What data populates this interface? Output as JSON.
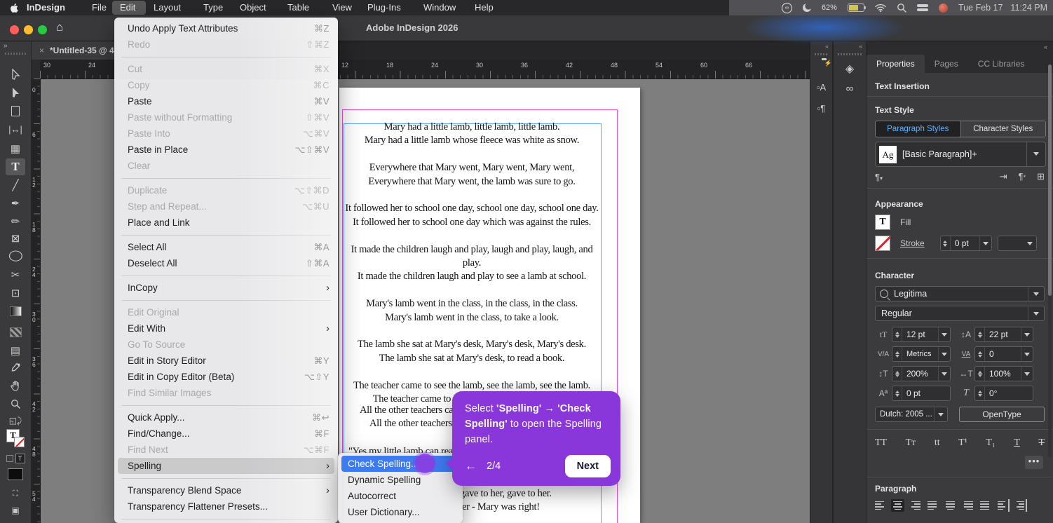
{
  "menubar": {
    "app_name": "InDesign",
    "items": [
      "File",
      "Edit",
      "Layout",
      "Type",
      "Object",
      "Table",
      "View",
      "Plug-Ins",
      "Window",
      "Help"
    ],
    "active_item": "Edit",
    "status": {
      "battery_percent": "62%",
      "date": "Tue Feb 17",
      "time": "11:24 PM"
    },
    "status_icons": [
      "creative-cloud-icon",
      "moon-icon",
      "battery-icon",
      "wifi-icon",
      "search-icon",
      "control-center-icon",
      "red-status-icon"
    ]
  },
  "titlebar": {
    "title": "Adobe InDesign 2026"
  },
  "document_tab": {
    "close": "×",
    "label": "*Untitled-35 @ 4"
  },
  "rulers": {
    "h_left": [
      "30",
      "24"
    ],
    "h_right": [
      "12",
      "18",
      "24",
      "30",
      "36",
      "42",
      "48",
      "54",
      "60",
      "66"
    ],
    "vertical": [
      "0",
      "6",
      "12",
      "18",
      "24",
      "30",
      "36",
      "42",
      "48",
      "54"
    ]
  },
  "toolbar": {
    "expander": "»",
    "tools": [
      "selection-tool",
      "direct-selection-tool",
      "page-tool",
      "gap-tool",
      "content-collector-tool",
      "type-tool",
      "line-tool",
      "pen-tool",
      "pencil-tool",
      "rectangle-frame-tool",
      "ellipse-tool",
      "scissors-tool",
      "free-transform-tool",
      "gradient-swatch-tool",
      "gradient-feather-tool",
      "note-tool",
      "eyedropper-tool",
      "hand-tool",
      "zoom-tool",
      "swap-fill-stroke",
      "fill-stroke-proxy",
      "formatting-toggles",
      "apply-color",
      "screen-mode"
    ],
    "active_tool": "type-tool"
  },
  "edit_menu": {
    "title": "Edit",
    "items": [
      {
        "label": "Undo Apply Text Attributes",
        "shortcut": "⌘Z",
        "enabled": true
      },
      {
        "label": "Redo",
        "shortcut": "⇧⌘Z",
        "enabled": false
      },
      {
        "label": "Cut",
        "shortcut": "⌘X",
        "enabled": false
      },
      {
        "label": "Copy",
        "shortcut": "⌘C",
        "enabled": false
      },
      {
        "label": "Paste",
        "shortcut": "⌘V",
        "enabled": true
      },
      {
        "label": "Paste without Formatting",
        "shortcut": "⇧⌘V",
        "enabled": false
      },
      {
        "label": "Paste Into",
        "shortcut": "⌥⌘V",
        "enabled": false
      },
      {
        "label": "Paste in Place",
        "shortcut": "⌥⇧⌘V",
        "enabled": true
      },
      {
        "label": "Clear",
        "shortcut": "",
        "enabled": false
      },
      {
        "label": "Duplicate",
        "shortcut": "⌥⇧⌘D",
        "enabled": false
      },
      {
        "label": "Step and Repeat...",
        "shortcut": "⌥⌘U",
        "enabled": false
      },
      {
        "label": "Place and Link",
        "shortcut": "",
        "enabled": true
      },
      {
        "label": "Select All",
        "shortcut": "⌘A",
        "enabled": true
      },
      {
        "label": "Deselect All",
        "shortcut": "⇧⌘A",
        "enabled": true
      },
      {
        "label": "InCopy",
        "shortcut": "›",
        "enabled": true
      },
      {
        "label": "Edit Original",
        "shortcut": "",
        "enabled": false
      },
      {
        "label": "Edit With",
        "shortcut": "›",
        "enabled": true
      },
      {
        "label": "Go To Source",
        "shortcut": "",
        "enabled": false
      },
      {
        "label": "Edit in Story Editor",
        "shortcut": "⌘Y",
        "enabled": true
      },
      {
        "label": "Edit in Copy Editor (Beta)",
        "shortcut": "⌥⇧Y",
        "enabled": true
      },
      {
        "label": "Find Similar Images",
        "shortcut": "",
        "enabled": false
      },
      {
        "label": "Quick Apply...",
        "shortcut": "⌘↩",
        "enabled": true
      },
      {
        "label": "Find/Change...",
        "shortcut": "⌘F",
        "enabled": true
      },
      {
        "label": "Find Next",
        "shortcut": "⌥⌘F",
        "enabled": false
      },
      {
        "label": "Spelling",
        "shortcut": "›",
        "enabled": true,
        "highlighted": true
      },
      {
        "label": "Transparency Blend Space",
        "shortcut": "›",
        "enabled": true
      },
      {
        "label": "Transparency Flattener Presets...",
        "shortcut": "",
        "enabled": true
      }
    ]
  },
  "spelling_submenu": {
    "items": [
      {
        "label": "Check Spelling...",
        "selected": true
      },
      {
        "label": "Dynamic Spelling",
        "selected": false
      },
      {
        "label": "Autocorrect",
        "selected": false
      },
      {
        "label": "User Dictionary...",
        "selected": false
      }
    ]
  },
  "tutorial_tooltip": {
    "text_runs": [
      {
        "t": "Select "
      },
      {
        "t": "'Spelling'"
      },
      {
        "t": " → "
      },
      {
        "t": "'Check Spelling'"
      },
      {
        "t": " to open the Spelling panel."
      }
    ],
    "back_icon": "←",
    "step": "2/4",
    "next_label": "Next",
    "accent_color": "#8936db"
  },
  "document": {
    "stanzas": [
      [
        "Mary had a little lamb, little lamb, little lamb.",
        "Mary had a little lamb whose fleece was white as snow."
      ],
      [
        "Everywhere that Mary went, Mary went, Mary went,",
        "Everywhere that Mary went, the lamb was sure to go."
      ],
      [
        "It followed her to school one day, school one day, school one day.",
        "It followed her to school one day which was against the rules."
      ],
      [
        "It made the children laugh and play, laugh and play, laugh, and play.",
        "It made the children laugh and play to see a lamb at school."
      ],
      [
        "Mary's lamb went in the class, in the class, in the class.",
        "Mary's lamb went in the class, to take a look."
      ],
      [
        "The lamb she sat at Mary's desk, Mary's desk, Mary's desk.",
        "The lamb she sat at Mary's desk, to read a book."
      ],
      [
        "The teacher came to see the lamb, see the lamb, see the lamb.",
        "The teacher came to see the lamb - what a surprise!"
      ]
    ],
    "fragments": [
      "All the other teachers came",
      "All the other teachers can",
      "\"Yes my little lamb can read",
      "gave to her, gave to her.",
      "er - Mary was right!"
    ],
    "guide_colors": {
      "margin": "#ec4fd8",
      "text_frame": "#58a8f5"
    }
  },
  "docks": {
    "dock1_icons": [
      "cc-libraries-icon",
      "character-styles-icon",
      "paragraph-styles-icon"
    ],
    "dock2_icons": [
      "layers-icon",
      "links-icon"
    ],
    "collapse_icon": "«"
  },
  "properties_panel": {
    "tabs": [
      "Properties",
      "Pages",
      "CC Libraries"
    ],
    "active_tab": "Properties",
    "text_insertion": "Text Insertion",
    "text_style": {
      "heading": "Text Style",
      "paragraph_styles": "Paragraph Styles",
      "character_styles": "Character Styles",
      "style_sample": "Ag",
      "style_name": "[Basic Paragraph]+"
    },
    "appearance": {
      "heading": "Appearance",
      "fill_label": "Fill",
      "stroke_label": "Stroke",
      "stroke_weight": "0 pt"
    },
    "character": {
      "heading": "Character",
      "font": "Legitima",
      "style": "Regular",
      "size": "12 pt",
      "leading": "22 pt",
      "kerning": "Metrics",
      "tracking": "0",
      "vertical_scale": "200%",
      "horizontal_scale": "100%",
      "baseline_shift": "0 pt",
      "skew": "0°",
      "language": "Dutch: 2005 ...",
      "opentype_label": "OpenType",
      "case_buttons": [
        "TT",
        "Tᴛ",
        "tt",
        "T¹",
        "T₁",
        "T",
        "T"
      ],
      "more": "•••"
    },
    "paragraph": {
      "heading": "Paragraph"
    }
  }
}
